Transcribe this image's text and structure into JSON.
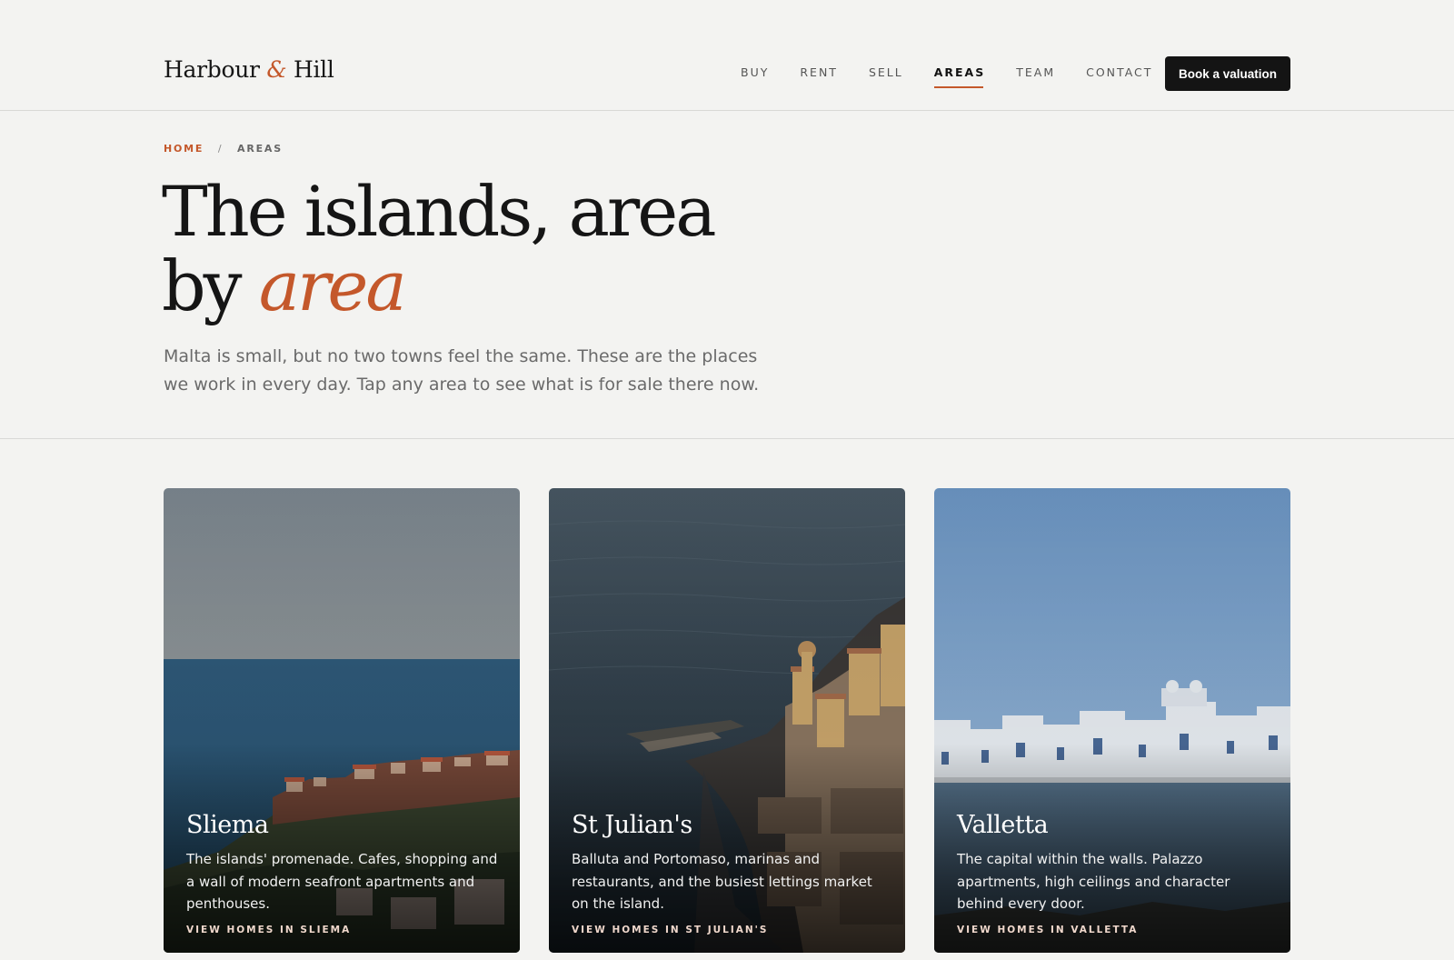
{
  "brand": {
    "name_first": "Harbour",
    "amp": "&",
    "name_last": "Hill"
  },
  "nav": {
    "items": [
      {
        "label": "BUY",
        "active": false
      },
      {
        "label": "RENT",
        "active": false
      },
      {
        "label": "SELL",
        "active": false
      },
      {
        "label": "AREAS",
        "active": true
      },
      {
        "label": "TEAM",
        "active": false
      },
      {
        "label": "CONTACT",
        "active": false
      }
    ],
    "cta_label": "Book a valuation"
  },
  "breadcrumb": {
    "home": "HOME",
    "separator": "/",
    "current": "AREAS"
  },
  "hero": {
    "title_line1": "The islands, area",
    "title_line2_prefix": "by",
    "title_line2_accent": "area",
    "intro": "Malta is small, but no two towns feel the same. These are the places we work in every day. Tap any area to see what is for sale there now."
  },
  "colors": {
    "accent": "#c4582b",
    "ink": "#151515",
    "background": "#f3f3f1",
    "button": "#141414"
  },
  "areas": [
    {
      "name": "Sliema",
      "description": "The islands' promenade. Cafes, shopping and a wall of modern seafront apartments and penthouses.",
      "link": "VIEW HOMES IN SLIEMA"
    },
    {
      "name": "St Julian's",
      "description": "Balluta and Portomaso, marinas and restaurants, and the busiest lettings market on the island.",
      "link": "VIEW HOMES IN ST JULIAN'S"
    },
    {
      "name": "Valletta",
      "description": "The capital within the walls. Palazzo apartments, high ceilings and character behind every door.",
      "link": "VIEW HOMES IN VALLETTA"
    }
  ]
}
